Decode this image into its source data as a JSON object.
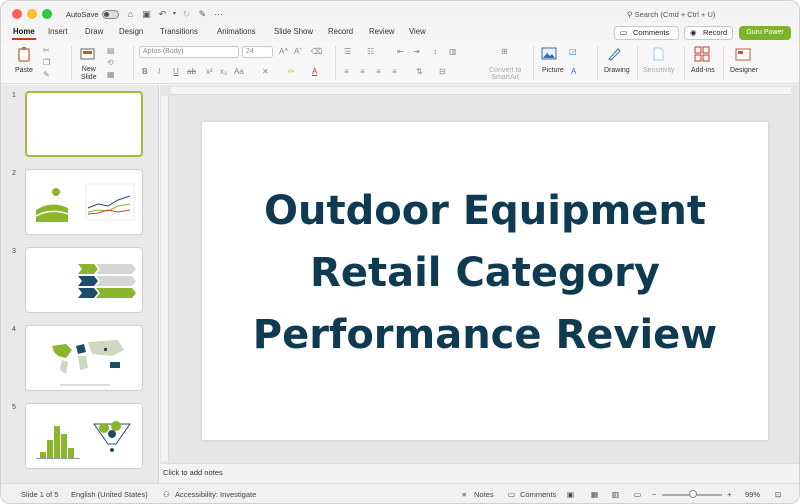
{
  "titlebar": {
    "autosave_label": "AutoSave",
    "search_placeholder": "Search (Cmd + Ctrl + U)",
    "more_glyph": "···"
  },
  "tabs": [
    {
      "label": "Home",
      "active": true
    },
    {
      "label": "Insert"
    },
    {
      "label": "Draw"
    },
    {
      "label": "Design"
    },
    {
      "label": "Transitions"
    },
    {
      "label": "Animations"
    },
    {
      "label": "Slide Show"
    },
    {
      "label": "Record"
    },
    {
      "label": "Review"
    },
    {
      "label": "View"
    }
  ],
  "tab_buttons": {
    "comments": "Comments",
    "record": "Record",
    "guru": "Guru Power"
  },
  "ribbon": {
    "paste": "Paste",
    "new_slide_line1": "New",
    "new_slide_line2": "Slide",
    "font_name": "Aptos (Body)",
    "font_size": "24",
    "convert_line1": "Convert to",
    "convert_line2": "SmartArt",
    "picture": "Picture",
    "drawing": "Drawing",
    "sensitivity": "Sensitivity",
    "addins": "Add-ins",
    "designer": "Designer",
    "bold": "B",
    "italic": "I",
    "underline": "U",
    "strike": "ab",
    "super": "x²",
    "sub": "x₂",
    "case": "Aa",
    "grow": "A^",
    "shrink": "Aˇ",
    "font_color": "A"
  },
  "slides": [
    {
      "number": "1",
      "selected": true
    },
    {
      "number": "2"
    },
    {
      "number": "3"
    },
    {
      "number": "4"
    },
    {
      "number": "5"
    }
  ],
  "slide": {
    "title_line1": "Outdoor Equipment",
    "title_line2": "Retail Category",
    "title_line3": "Performance Review"
  },
  "notes_placeholder": "Click to add notes",
  "status": {
    "slide_count": "Slide 1 of 5",
    "language": "English (United States)",
    "accessibility": "Accessibility: Investigate",
    "notes": "Notes",
    "comments": "Comments",
    "zoom": "99%"
  },
  "colors": {
    "accent_tab": "#c43e1c",
    "guru_button": "#7db32a",
    "title_text": "#0e3a52",
    "thumb_selected": "#a8b840"
  }
}
